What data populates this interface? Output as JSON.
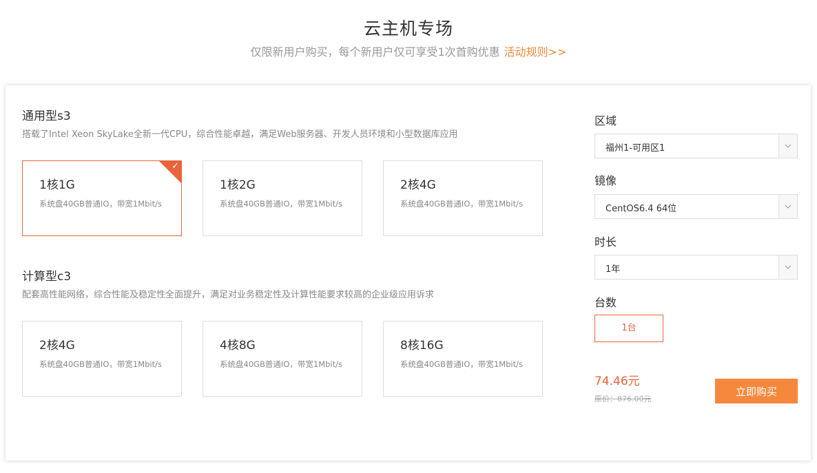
{
  "header": {
    "title": "云主机专场",
    "subtitle": "仅限新用户购买，每个新用户仅可享受1次首购优惠",
    "rules_link": "活动规则>>"
  },
  "sections": [
    {
      "title": "通用型s3",
      "desc": "搭载了Intel Xeon SkyLake全新一代CPU，综合性能卓越，满足Web服务器、开发人员环境和小型数据库应用",
      "cards": [
        {
          "spec": "1核1G",
          "desc": "系统盘40GB普通IO，带宽1Mbit/s",
          "selected": true
        },
        {
          "spec": "1核2G",
          "desc": "系统盘40GB普通IO，带宽1Mbit/s",
          "selected": false
        },
        {
          "spec": "2核4G",
          "desc": "系统盘40GB普通IO，带宽1Mbit/s",
          "selected": false
        }
      ]
    },
    {
      "title": "计算型c3",
      "desc": "配套高性能网络，综合性能及稳定性全面提升，满足对业务稳定性及计算性能要求较高的企业级应用诉求",
      "cards": [
        {
          "spec": "2核4G",
          "desc": "系统盘40GB普通IO，带宽1Mbit/s",
          "selected": false
        },
        {
          "spec": "4核8G",
          "desc": "系统盘40GB普通IO，带宽1Mbit/s",
          "selected": false
        },
        {
          "spec": "8核16G",
          "desc": "系统盘40GB普通IO，带宽1Mbit/s",
          "selected": false
        }
      ]
    }
  ],
  "config": {
    "region_label": "区域",
    "region_value": "福州1-可用区1",
    "image_label": "镜像",
    "image_value": "CentOS6.4 64位",
    "duration_label": "时长",
    "duration_value": "1年",
    "quantity_label": "台数",
    "quantity_value": "1台"
  },
  "purchase": {
    "price": "74.46元",
    "original_price": "原价：876.00元",
    "buy_label": "立即购买"
  },
  "colors": {
    "accent": "#e8643a",
    "button": "#f5883c",
    "link": "#f08a3e"
  }
}
